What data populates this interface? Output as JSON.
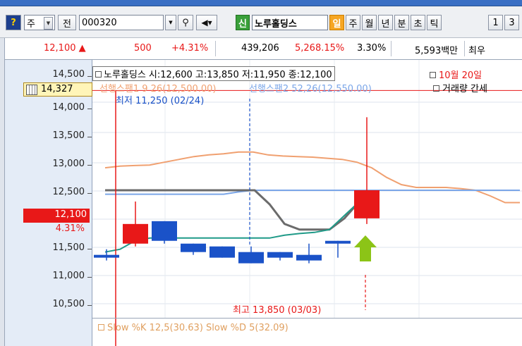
{
  "toolbar": {
    "market_select": "주",
    "prefix_label": "전",
    "code_value": "000320",
    "stock_name": "노루홀딩스",
    "new_badge": "신",
    "period_tabs": [
      "일",
      "주",
      "월",
      "년",
      "분",
      "초",
      "틱"
    ],
    "active_tab": "일",
    "num_tabs": [
      "1",
      "3"
    ]
  },
  "quote": {
    "price": "12,100",
    "change": "500",
    "change_pct": "+4.31%",
    "volume": "439,206",
    "vol_ratio": "5,268.15%",
    "turnover": "3.30%",
    "amount": "5,593백만",
    "extra": "최우"
  },
  "axis": {
    "labels": [
      "14,500",
      "14,000",
      "13,500",
      "13,000",
      "12,500",
      "12,000",
      "11,500",
      "11,000",
      "10,500"
    ],
    "high_mark": "14,327",
    "current_price": "12,100",
    "current_pct": "4.31%"
  },
  "legend": {
    "info": "노루홀딩스 시:12,600 고:13,850 저:11,950 종:12,100",
    "date": "10월 20일",
    "span1": "선행스팬1 9 26(12,500.00)",
    "span2": "선행스팬2 52,26(12,550.00)",
    "volume_label": "거래량 간세",
    "low_note": "최저 11,250 (02/24)",
    "high_note": "최고 13,850 (03/03)",
    "stoch": "Slow %K 12,5(30.63)  Slow %D 5(32.09)"
  },
  "colors": {
    "up": "#e81818",
    "down": "#1a52c8",
    "span1": "#f0a070",
    "span2": "#7ba6e8",
    "gray_line": "#6b6b6b",
    "teal_line": "#1f9a88",
    "arrow": "#8cc417"
  },
  "chart_data": {
    "type": "candlestick",
    "ylim": [
      10250,
      14700
    ],
    "candles": [
      {
        "open": 11400,
        "close": 11350,
        "high": 11500,
        "low": 11300
      },
      {
        "open": 11600,
        "close": 11950,
        "high": 12350,
        "low": 11550
      },
      {
        "open": 12000,
        "close": 11650,
        "high": 12000,
        "low": 11600
      },
      {
        "open": 11600,
        "close": 11450,
        "high": 11600,
        "low": 11400
      },
      {
        "open": 11550,
        "close": 11350,
        "high": 11550,
        "low": 11350
      },
      {
        "open": 11450,
        "close": 11250,
        "high": 11550,
        "low": 11250
      },
      {
        "open": 11450,
        "close": 11350,
        "high": 11450,
        "low": 11300
      },
      {
        "open": 11400,
        "close": 11300,
        "high": 11600,
        "low": 11250
      },
      {
        "open": 11650,
        "close": 11600,
        "high": 11650,
        "low": 11350
      },
      {
        "open": 12050,
        "close": 12550,
        "high": 13850,
        "low": 11950
      }
    ],
    "span1_line": [
      12950,
      12980,
      12990,
      13000,
      13050,
      13100,
      13150,
      13180,
      13200,
      13230,
      13230,
      13180,
      13160,
      13150,
      13140,
      13120,
      13100,
      13050,
      12950,
      12780,
      12650,
      12600,
      12600,
      12600,
      12580,
      12550,
      12450,
      12330,
      12330
    ],
    "blue_line": [
      12480,
      12480,
      12480,
      12480,
      12480,
      12480,
      12480,
      12480,
      12480,
      12520,
      12550,
      12550,
      12550,
      12550,
      12550,
      12550,
      12550,
      12550,
      12550,
      12550,
      12550,
      12550,
      12550,
      12550,
      12550,
      12550,
      12550,
      12550,
      12550
    ],
    "gray_line": [
      12550,
      12550,
      12550,
      12550,
      12550,
      12550,
      12550,
      12550,
      12550,
      12550,
      12550,
      12300,
      11950,
      11850,
      11850,
      11850,
      12050,
      12350
    ],
    "teal_line": [
      11450,
      11500,
      11650,
      11700,
      11700,
      11700,
      11700,
      11700,
      11700,
      11700,
      11700,
      11700,
      11750,
      11780,
      11800,
      11850,
      12100,
      12350
    ]
  }
}
